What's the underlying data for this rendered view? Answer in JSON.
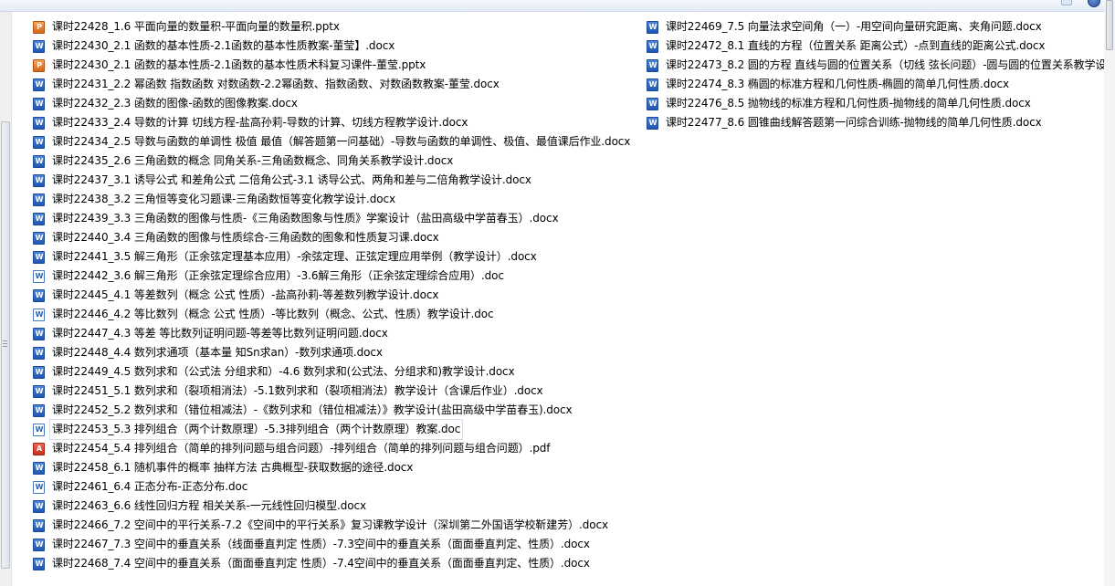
{
  "files_left": [
    {
      "type": "pptx",
      "name": "课时22428_1.6 平面向量的数量积-平面向量的数量积.pptx"
    },
    {
      "type": "docx",
      "name": "课时22430_2.1 函数的基本性质-2.1函数的基本性质教案-董莹】.docx"
    },
    {
      "type": "pptx",
      "name": "课时22430_2.1 函数的基本性质-2.1函数的基本性质术科复习课件-董莹.pptx"
    },
    {
      "type": "docx",
      "name": "课时22431_2.2 幂函数 指数函数 对数函数-2.2幂函数、指数函数、对数函数教案-董莹.docx"
    },
    {
      "type": "docx",
      "name": "课时22432_2.3 函数的图像-函数的图像教案.docx"
    },
    {
      "type": "docx",
      "name": "课时22433_2.4 导数的计算 切线方程-盐高孙莉-导数的计算、切线方程教学设计.docx"
    },
    {
      "type": "docx",
      "name": "课时22434_2.5 导数与函数的单调性 极值 最值（解答题第一问基础）-导数与函数的单调性、极值、最值课后作业.docx"
    },
    {
      "type": "docx",
      "name": "课时22435_2.6 三角函数的概念 同角关系-三角函数概念、同角关系教学设计.docx"
    },
    {
      "type": "docx",
      "name": "课时22437_3.1 诱导公式 和差角公式 二倍角公式-3.1 诱导公式、两角和差与二倍角教学设计.docx"
    },
    {
      "type": "docx",
      "name": "课时22438_3.2 三角恒等变化习题课-三角函数恒等变化教学设计.docx"
    },
    {
      "type": "docx",
      "name": "课时22439_3.3 三角函数的图像与性质-《三角函数图象与性质》学案设计（盐田高级中学苗春玉）.docx"
    },
    {
      "type": "docx",
      "name": "课时22440_3.4 三角函数的图像与性质综合-三角函数的图象和性质复习课.docx"
    },
    {
      "type": "docx",
      "name": "课时22441_3.5 解三角形（正余弦定理基本应用）-余弦定理、正弦定理应用举例（教学设计）.docx"
    },
    {
      "type": "doc",
      "name": "课时22442_3.6 解三角形（正余弦定理综合应用）-3.6解三角形（正余弦定理综合应用）.doc"
    },
    {
      "type": "docx",
      "name": "课时22445_4.1 等差数列（概念 公式 性质）-盐高孙莉-等差数列教学设计.docx"
    },
    {
      "type": "doc",
      "name": "课时22446_4.2 等比数列（概念 公式 性质）-等比数列（概念、公式、性质）教学设计.doc"
    },
    {
      "type": "docx",
      "name": "课时22447_4.3 等差 等比数列证明问题-等差等比数列证明问题.docx"
    },
    {
      "type": "docx",
      "name": "课时22448_4.4 数列求通项（基本量 知Sn求an）-数列求通项.docx"
    },
    {
      "type": "docx",
      "name": "课时22449_4.5 数列求和（公式法 分组求和）-4.6 数列求和(公式法、分组求和)教学设计.docx"
    },
    {
      "type": "docx",
      "name": "课时22451_5.1 数列求和（裂项相消法）-5.1数列求和（裂项相消法）教学设计（含课后作业）.docx"
    },
    {
      "type": "docx",
      "name": "课时22452_5.2 数列求和（错位相减法）-《数列求和（错位相减法）》教学设计(盐田高级中学苗春玉).docx"
    },
    {
      "type": "doc",
      "name": "课时22453_5.3 排列组合（两个计数原理）-5.3排列组合（两个计数原理）教案.doc",
      "selected": true
    },
    {
      "type": "pdf",
      "name": "课时22454_5.4 排列组合（简单的排列问题与组合问题）-排列组合（简单的排列问题与组合问题）.pdf"
    },
    {
      "type": "docx",
      "name": "课时22458_6.1 随机事件的概率 抽样方法 古典概型-获取数据的途径.docx"
    },
    {
      "type": "doc",
      "name": "课时22461_6.4 正态分布-正态分布.doc"
    },
    {
      "type": "docx",
      "name": "课时22463_6.6 线性回归方程 相关关系-一元线性回归模型.docx"
    },
    {
      "type": "docx",
      "name": "课时22466_7.2 空间中的平行关系-7.2《空间中的平行关系》复习课教学设计（深圳第二外国语学校靳建芳）.docx"
    },
    {
      "type": "docx",
      "name": "课时22467_7.3 空间中的垂直关系（线面垂直判定 性质）-7.3空间中的垂直关系（面面垂直判定、性质）.docx"
    },
    {
      "type": "docx",
      "name": "课时22468_7.4 空间中的垂直关系（面面垂直判定 性质）-7.4空间中的垂直关系（面面垂直判定、性质）.docx"
    }
  ],
  "files_right": [
    {
      "type": "docx",
      "name": "课时22469_7.5 向量法求空间角（一）-用空间向量研究距离、夹角问题.docx"
    },
    {
      "type": "docx",
      "name": "课时22472_8.1 直线的方程（位置关系 距离公式）-点到直线的距离公式.docx"
    },
    {
      "type": "docx",
      "name": "课时22473_8.2 圆的方程 直线与圆的位置关系（切线 弦长问题）-圆与圆的位置关系教学设计"
    },
    {
      "type": "docx",
      "name": "课时22474_8.3 椭圆的标准方程和几何性质-椭圆的简单几何性质.docx"
    },
    {
      "type": "docx",
      "name": "课时22476_8.5 抛物线的标准方程和几何性质-抛物线的简单几何性质.docx"
    },
    {
      "type": "docx",
      "name": "课时22477_8.6 圆锥曲线解答题第一问综合训练-抛物线的简单几何性质.docx"
    }
  ]
}
